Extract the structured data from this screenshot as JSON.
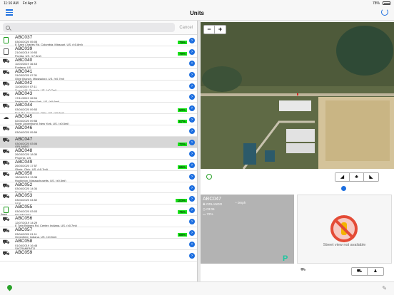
{
  "status": {
    "time": "11:16 AM",
    "date": "Fri Apr 3",
    "battery": "78%"
  },
  "nav": {
    "title": "Units"
  },
  "search": {
    "placeholder": "",
    "cancel": "Cancel"
  },
  "units": [
    {
      "name": "ABC037",
      "stamp": "03/04/2020 05:05",
      "addr": "E Saint Charles Rd, Columbia, Missouri, US, (±0.8mi)",
      "badge": "79%",
      "icon": "device-green"
    },
    {
      "name": "ABC039",
      "stamp": "21/04/2019 19:53",
      "addr": "Florida, US, (±7.5mi)",
      "badge": "79%",
      "icon": "device"
    },
    {
      "name": "ABC040",
      "stamp": "11/03/2019 16:48",
      "addr": "Fontana, US",
      "badge": "",
      "icon": "truck"
    },
    {
      "name": "ABC041",
      "stamp": "31/03/2020 07:31",
      "addr": "Olive Branch, Mississippi, US, (±0.7mi)",
      "badge": "",
      "icon": "truck"
    },
    {
      "name": "ABC042",
      "stamp": "11/08/2019 07:11",
      "addr": "Sugar Hill, Georgia, US, (±0.7mi)",
      "badge": "",
      "icon": "truck"
    },
    {
      "name": "ABC043",
      "stamp": "17/11/2019 10:56",
      "addr": "Newburgh, New York, US, (±0.6mi)",
      "badge": "",
      "icon": "truck"
    },
    {
      "name": "ABC044",
      "stamp": "03/04/2020 09:53",
      "addr": "Port Rd, Groveport, Ohio, US, (±0.6mi)",
      "badge": "50%",
      "icon": "truck"
    },
    {
      "name": "ABC045",
      "stamp": "02/04/2020 09:58",
      "addr": "North Lindenhurst, New York, US, (±0.5mi)",
      "badge": "67%",
      "icon": "chat"
    },
    {
      "name": "ABC046",
      "stamp": "03/04/2020 05:59",
      "addr": "",
      "badge": "",
      "icon": "truck"
    },
    {
      "name": "ABC047",
      "stamp": "03/04/2020 03:06",
      "addr": "ORLANDO",
      "badge": "72%",
      "icon": "truck",
      "selected": true
    },
    {
      "name": "ABC048",
      "stamp": "26/03/2020 18:30",
      "addr": "Phoenix, US",
      "badge": "",
      "icon": "truck"
    },
    {
      "name": "ABC049",
      "stamp": "26/03/2020 17:57",
      "addr": "Obetz, Ohio, US, (±0.7mi)",
      "badge": "66%",
      "icon": "truck"
    },
    {
      "name": "ABC050",
      "stamp": "18/06/2019 13:38",
      "addr": "Hopkinton, Massachusetts, US, (±0.5mi)",
      "badge": "",
      "icon": "truck"
    },
    {
      "name": "ABC052",
      "stamp": "03/04/2020 14:34",
      "addr": "Pearland, US",
      "badge": "",
      "icon": "truck"
    },
    {
      "name": "ABC053",
      "stamp": "03/04/2020 04:52",
      "addr": "DDS",
      "badge": "100%",
      "icon": "truck"
    },
    {
      "name": "ABC055",
      "stamp": "03/04/2020 03:03",
      "addr": "RICHMOND",
      "badge": "75%",
      "icon": "device-green",
      "speed": "0mph"
    },
    {
      "name": "ABC056",
      "stamp": "12/07/2019 14:29",
      "addr": "E Twin Bridges Rd, Center, Indiana, US, (±0.7mi)",
      "badge": "",
      "icon": "truck"
    },
    {
      "name": "ABC057",
      "stamp": "03/04/2020 01:11",
      "addr": "Greenfield, Indiana, US, (±0.5mi)",
      "badge": "88%",
      "icon": "truck"
    },
    {
      "name": "ABC058",
      "stamp": "01/04/2019 16:48",
      "addr": "SACRAMENTO",
      "badge": "",
      "icon": "truck"
    },
    {
      "name": "ABC059",
      "stamp": "",
      "addr": "",
      "badge": "",
      "icon": "truck"
    }
  ],
  "map": {
    "zoom_out": "−",
    "zoom_in": "+"
  },
  "maptools": {
    "layer1": "◢",
    "layer2": "♣",
    "layer3": "◣"
  },
  "info": {
    "name": "ABC047",
    "city": "ORLANDO",
    "time": "03:06",
    "battery": "72%",
    "speed": "0mph"
  },
  "streetview": {
    "text": "Street view not available"
  },
  "svtools": {
    "b1": "⛟",
    "b2": "⛟",
    "b3": "♟"
  }
}
